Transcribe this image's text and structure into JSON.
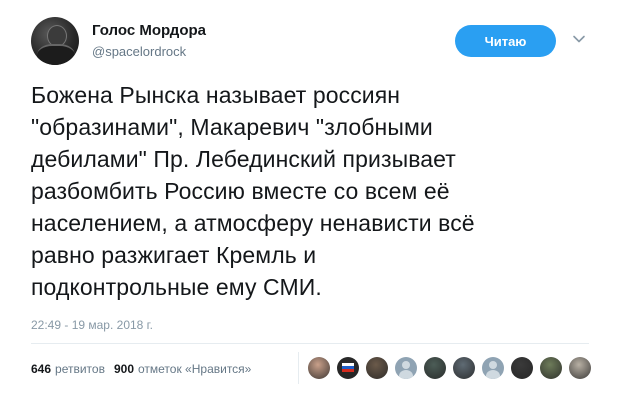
{
  "author": {
    "name": "Голос Мордора",
    "handle": "@spacelordrock"
  },
  "follow_button": {
    "label": "Читаю"
  },
  "tweet": {
    "text": "Божена Рынска называет россиян\n\"образинами\", Макаревич \"злобными\nдебилами\" Пр. Лебединский призывает\nразбомбить Россию вместе со всем её\nнаселением, а атмосферу ненависти всё\nравно разжигает Кремль и\nподконтрольные ему СМИ.",
    "timestamp": "22:49 - 19 мар. 2018 г."
  },
  "stats": {
    "retweets_count": "646",
    "retweets_label": "ретвитов",
    "likes_count": "900",
    "likes_label": "отметок «Нравится»"
  },
  "colors": {
    "follow_button_bg": "#2a9ff2",
    "secondary_text": "#657786"
  },
  "likers": [
    {
      "icon": "liker-avatar-1",
      "color": "#c9a08a"
    },
    {
      "icon": "liker-avatar-flag",
      "color": "#2b2b2b"
    },
    {
      "icon": "liker-avatar-3",
      "color": "#6b5a4a"
    },
    {
      "icon": "default-avatar-icon",
      "color": "#8fa3b3"
    },
    {
      "icon": "liker-avatar-5",
      "color": "#4c5d57"
    },
    {
      "icon": "liker-avatar-6",
      "color": "#5f6b74"
    },
    {
      "icon": "default-avatar-icon",
      "color": "#8fa3b3"
    },
    {
      "icon": "liker-avatar-8",
      "color": "#3a3a3a"
    },
    {
      "icon": "liker-avatar-9",
      "color": "#6e7c5a"
    },
    {
      "icon": "liker-avatar-10",
      "color": "#b8b0a4"
    }
  ]
}
